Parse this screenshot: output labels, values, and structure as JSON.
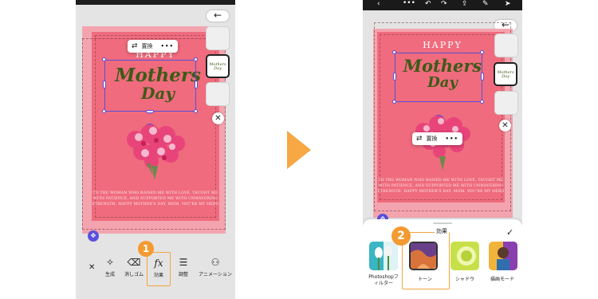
{
  "left_screen": {
    "back_arrow": "←",
    "card": {
      "happy": "HAPPY",
      "title_line1": "Mothers",
      "title_line2": "Day",
      "poem_line1": "TO THE WOMAN WHO RAISED ME WITH LOVE, TAUGHT ME",
      "poem_line2": "WITH PATIENCE, AND SUPPORTED ME WITH UNWAVERING",
      "poem_line3": "STRENGTH. HAPPY MOTHER'S DAY, MOM. YOU'RE MY HERO"
    },
    "popup": {
      "icon": "replace-icon",
      "label": "置換",
      "more": "•••"
    },
    "thumbnail_text": "Mothers Day",
    "close": "✕",
    "toolbar": {
      "close": "✕",
      "items": [
        {
          "icon": "generate-icon",
          "label": "生成"
        },
        {
          "icon": "eraser-icon",
          "label": "消しゴム"
        },
        {
          "icon": "fx-icon",
          "label": "効果"
        },
        {
          "icon": "adjust-icon",
          "label": "調整"
        },
        {
          "icon": "animation-icon",
          "label": "アニメーション"
        }
      ],
      "selected": "効果"
    },
    "step_badge": "1"
  },
  "right_screen": {
    "topbar_icons": [
      "back-icon",
      "more-icon",
      "undo-icon",
      "redo-icon",
      "share-icon",
      "pen-icon",
      "send-icon"
    ],
    "card": {
      "happy": "HAPPY",
      "title_line1": "Mothers",
      "title_line2": "Day",
      "poem_line1": "TO THE WOMAN WHO RAISED ME WITH LOVE, TAUGHT ME",
      "poem_line2": "WITH PATIENCE, AND SUPPORTED ME WITH UNWAVERING",
      "poem_line3": "STRENGTH. HAPPY MOTHER'S DAY, MOM. YOU'RE MY HERO"
    },
    "popup": {
      "icon": "replace-icon",
      "label": "置換",
      "more": "•••"
    },
    "back_arrow": "←",
    "close": "✕",
    "effects_panel": {
      "confirm": "✓",
      "tooltip": "効果",
      "items": [
        {
          "label_line1": "Photoshopフ",
          "label_line2": "ィルター"
        },
        {
          "label_line1": "トーン",
          "label_line2": ""
        },
        {
          "label_line1": "シャドウ",
          "label_line2": ""
        },
        {
          "label_line1": "描画モード",
          "label_line2": ""
        }
      ],
      "selected": "トーン"
    },
    "step_badge": "2"
  },
  "colors": {
    "card_pink": "#ef6b7d",
    "card_back": "#f3a4ae",
    "selection": "#5a4fdc",
    "highlight": "#f4a540",
    "script_green": "#3e5a18"
  }
}
